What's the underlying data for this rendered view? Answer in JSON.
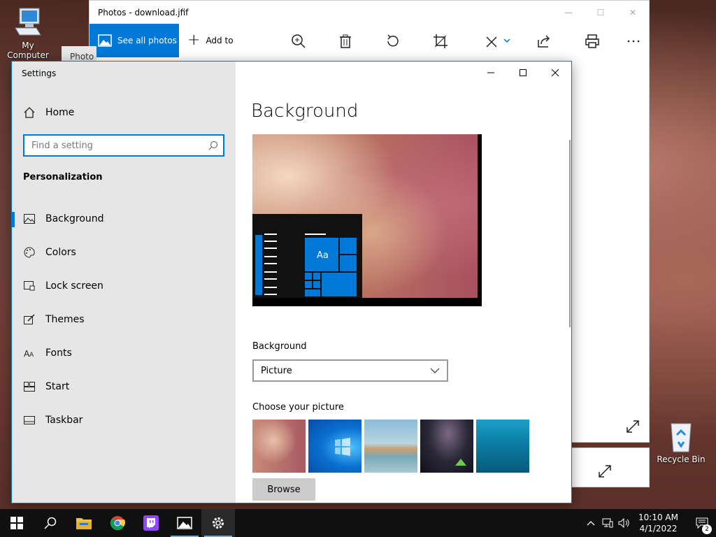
{
  "desktop": {
    "icons": [
      {
        "label": "My Computer"
      },
      {
        "label": "Recycle Bin"
      }
    ]
  },
  "photos": {
    "title": "Photos - download.jfif",
    "tab_label": "Photo",
    "see_all_label": "See all photos",
    "add_to_label": "Add to",
    "toolbar_icons": [
      "zoom-icon",
      "delete-icon",
      "rotate-icon",
      "crop-icon",
      "edit-icon",
      "share-icon",
      "print-icon",
      "more-icon"
    ]
  },
  "settings": {
    "window_title": "Settings",
    "home_label": "Home",
    "search_placeholder": "Find a setting",
    "section": "Personalization",
    "nav": [
      {
        "label": "Background",
        "icon": "picture-icon",
        "active": true
      },
      {
        "label": "Colors",
        "icon": "palette-icon",
        "active": false
      },
      {
        "label": "Lock screen",
        "icon": "lock-screen-icon",
        "active": false
      },
      {
        "label": "Themes",
        "icon": "themes-icon",
        "active": false
      },
      {
        "label": "Fonts",
        "icon": "fonts-icon",
        "active": false
      },
      {
        "label": "Start",
        "icon": "start-icon",
        "active": false
      },
      {
        "label": "Taskbar",
        "icon": "taskbar-icon",
        "active": false
      }
    ],
    "page_title": "Background",
    "preview_tile_text": "Aa",
    "background_label": "Background",
    "background_value": "Picture",
    "choose_label": "Choose your picture",
    "browse_label": "Browse"
  },
  "taskbar": {
    "time": "10:10 AM",
    "date": "4/1/2022",
    "notification_count": "2",
    "apps": [
      "start-icon",
      "search-icon",
      "file-explorer-icon",
      "chrome-icon",
      "twitch-icon",
      "photos-icon",
      "settings-icon"
    ]
  },
  "colors": {
    "accent": "#0078d7",
    "sidebar_bg": "#e6e6e6",
    "taskbar_bg": "#101010"
  }
}
